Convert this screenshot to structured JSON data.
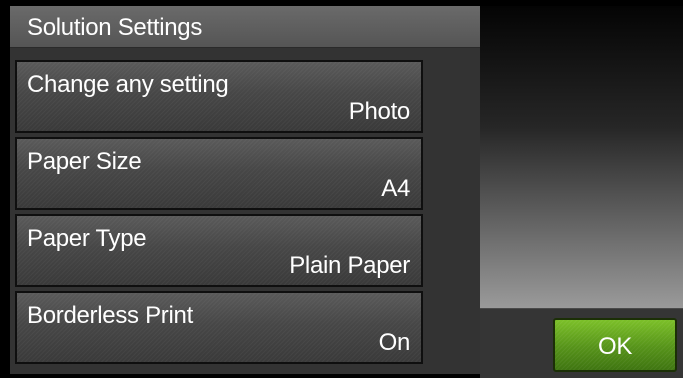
{
  "header": {
    "title": "Solution Settings"
  },
  "settings": {
    "items": [
      {
        "label": "Change any setting",
        "value": "Photo"
      },
      {
        "label": "Paper Size",
        "value": "A4"
      },
      {
        "label": "Paper Type",
        "value": "Plain Paper"
      },
      {
        "label": "Borderless Print",
        "value": "On"
      }
    ]
  },
  "actions": {
    "ok_label": "OK"
  },
  "colors": {
    "ok_button": "#56931a",
    "panel": "#333333",
    "title_bar": "#5e5e5e"
  }
}
